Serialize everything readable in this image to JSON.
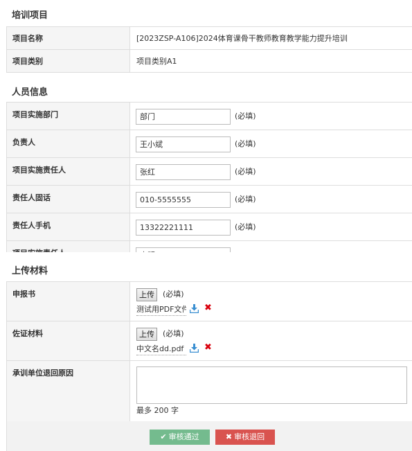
{
  "project": {
    "section_title": "培训项目",
    "rows": [
      {
        "label": "项目名称",
        "value": "[2023ZSP-A106]2024体育课骨干教师教育教学能力提升培训"
      },
      {
        "label": "项目类别",
        "value": "项目类别A1"
      }
    ]
  },
  "personnel": {
    "section_title": "人员信息",
    "required_text": "(必填)",
    "rows": [
      {
        "label": "项目实施部门",
        "value": "部门"
      },
      {
        "label": "负责人",
        "value": "王小斌"
      },
      {
        "label": "项目实施责任人",
        "value": "张红"
      },
      {
        "label": "责任人固话",
        "value": "010-5555555"
      },
      {
        "label": "责任人手机",
        "value": "13322221111"
      },
      {
        "label": "项目实施责任人",
        "value": "李明"
      }
    ]
  },
  "materials": {
    "section_title": "上传材料",
    "upload_label": "上传",
    "required_text": "(必填)",
    "rows": [
      {
        "label": "申报书",
        "file_name": "测试用PDF文件.pdf"
      },
      {
        "label": "佐证材料",
        "file_name": "中文名dd.pdf"
      }
    ],
    "reason": {
      "label": "承训单位退回原因",
      "value": "",
      "limit_text": "最多 200 字"
    }
  },
  "actions": {
    "approve_label": "审核通过",
    "reject_label": "审核退回"
  },
  "colors": {
    "approve": "#74bb8e",
    "reject": "#d9534f",
    "download_icon": "#3a8fd1",
    "delete_icon": "#d9000d"
  }
}
